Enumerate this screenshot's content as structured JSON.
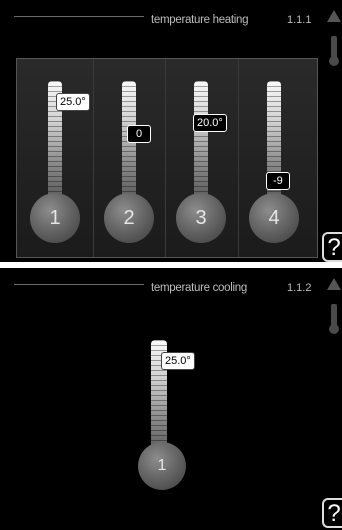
{
  "heating": {
    "title": "temperature heating",
    "menu_number": "1.1.1",
    "help_label": "?",
    "thermometers": [
      {
        "label": "1",
        "value": "25.0°",
        "style": "light"
      },
      {
        "label": "2",
        "value": "0",
        "style": "dark"
      },
      {
        "label": "3",
        "value": "20.0°",
        "style": "dark"
      },
      {
        "label": "4",
        "value": "-9",
        "style": "dark"
      }
    ]
  },
  "cooling": {
    "title": "temperature cooling",
    "menu_number": "1.1.2",
    "help_label": "?",
    "thermometers": [
      {
        "label": "1",
        "value": "25.0°",
        "style": "light"
      }
    ]
  },
  "icons": {
    "top_right": "house-icon",
    "thermometer": "thermometer-icon"
  }
}
